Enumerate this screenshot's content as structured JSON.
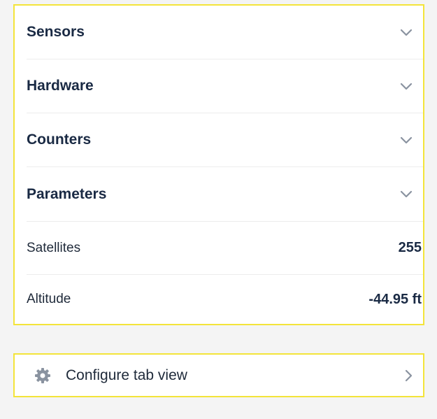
{
  "sections": [
    {
      "title": "Sensors",
      "icon": "chevron-down-icon"
    },
    {
      "title": "Hardware",
      "icon": "chevron-down-icon"
    },
    {
      "title": "Counters",
      "icon": "chevron-down-icon"
    },
    {
      "title": "Parameters",
      "icon": "chevron-down-icon"
    }
  ],
  "parameters": [
    {
      "label": "Satellites",
      "value": "255"
    },
    {
      "label": "Altitude",
      "value": "-44.95 ft"
    }
  ],
  "configure": {
    "label": "Configure tab view",
    "icon": "gear-icon",
    "arrow_icon": "chevron-right-icon"
  },
  "colors": {
    "highlight_border": "#f3e43a",
    "text_dark": "#1a2a44",
    "icon_gray": "#8a93a0",
    "background": "#f4f4f4"
  }
}
